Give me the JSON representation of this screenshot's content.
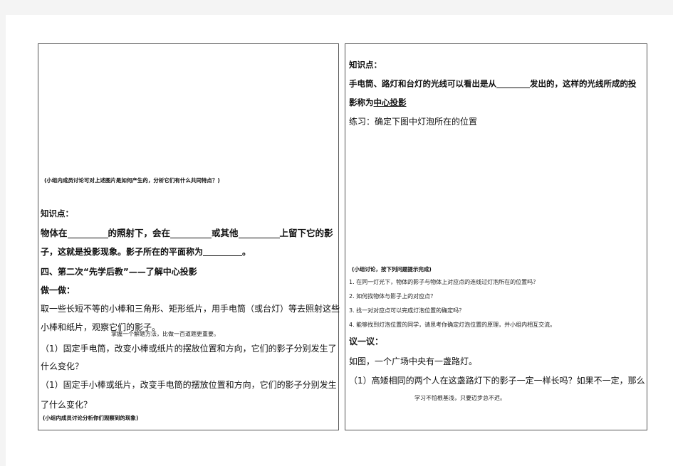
{
  "left": {
    "group_note_1": "(小组内成员讨论可对上述图片是如何产生的，分析它们有什么共同特点？)",
    "knowledge_title": "知识点：",
    "def_1a": "物体在",
    "def_1b": "的照射下，会在",
    "def_1c": "或其他",
    "def_1d": "上留下它的影",
    "def_2a": "子，这就是投影现象。影子所在的平面称为",
    "def_2b": "。",
    "section_four": "四、第二次“先学后教”——了解中心投影",
    "do_it": "做一做：",
    "activity_1": "取一些长短不等的小棒和三角形、矩形纸片，用手电筒（或台灯）等去照射这些",
    "activity_2": "小棒和纸片，观察它们的影子。",
    "overlay_note": "掌握一个解题方法，比做一百道题更重要。",
    "q1a": "（1）固定手电筒，改变小棒或纸片的摆放位置和方向，它们的影子分别发生了",
    "q1b": "什么变化？",
    "q2a": "（1）固定手小棒或纸片，改变手电筒的摆放位置和方向，它们的影子分别发生",
    "q2b": "了什么变化？",
    "group_note_2": "(小组内成员讨论分析你们观察到的现象)"
  },
  "right": {
    "knowledge_title": "知识点：",
    "line1a": "手电筒、路灯和台灯的光线可以看出是从",
    "line1b": "发出的，这样的光线所成的投",
    "line2a": "影称为",
    "line2b": "中心投影",
    "exercise": "练习：确定下图中灯泡所在的位置",
    "group_note": "(小组讨论，按下列问题提示完成)",
    "hints": [
      "1. 在同一灯光下，物体的影子与物体上对应点的连线过灯泡所在的位置吗？",
      "2.  如何找物体与影子上的对应点？",
      "3.  找一对对应点可以完成灯泡位置的确定吗？",
      "4. 能够找到灯泡位置的同学，请思考你确定灯泡位置的原理，并小组内相互交流。"
    ],
    "discuss_title": "议一议：",
    "discuss_1": "如图，一个广场中央有一盏路灯。",
    "discuss_2": "（1）高矮相同的两个人在这盏路灯下的影子一定一样长吗？如果不一定，那么",
    "footer_note": "学习不怕根基浅，只要迈步总不迟。"
  }
}
